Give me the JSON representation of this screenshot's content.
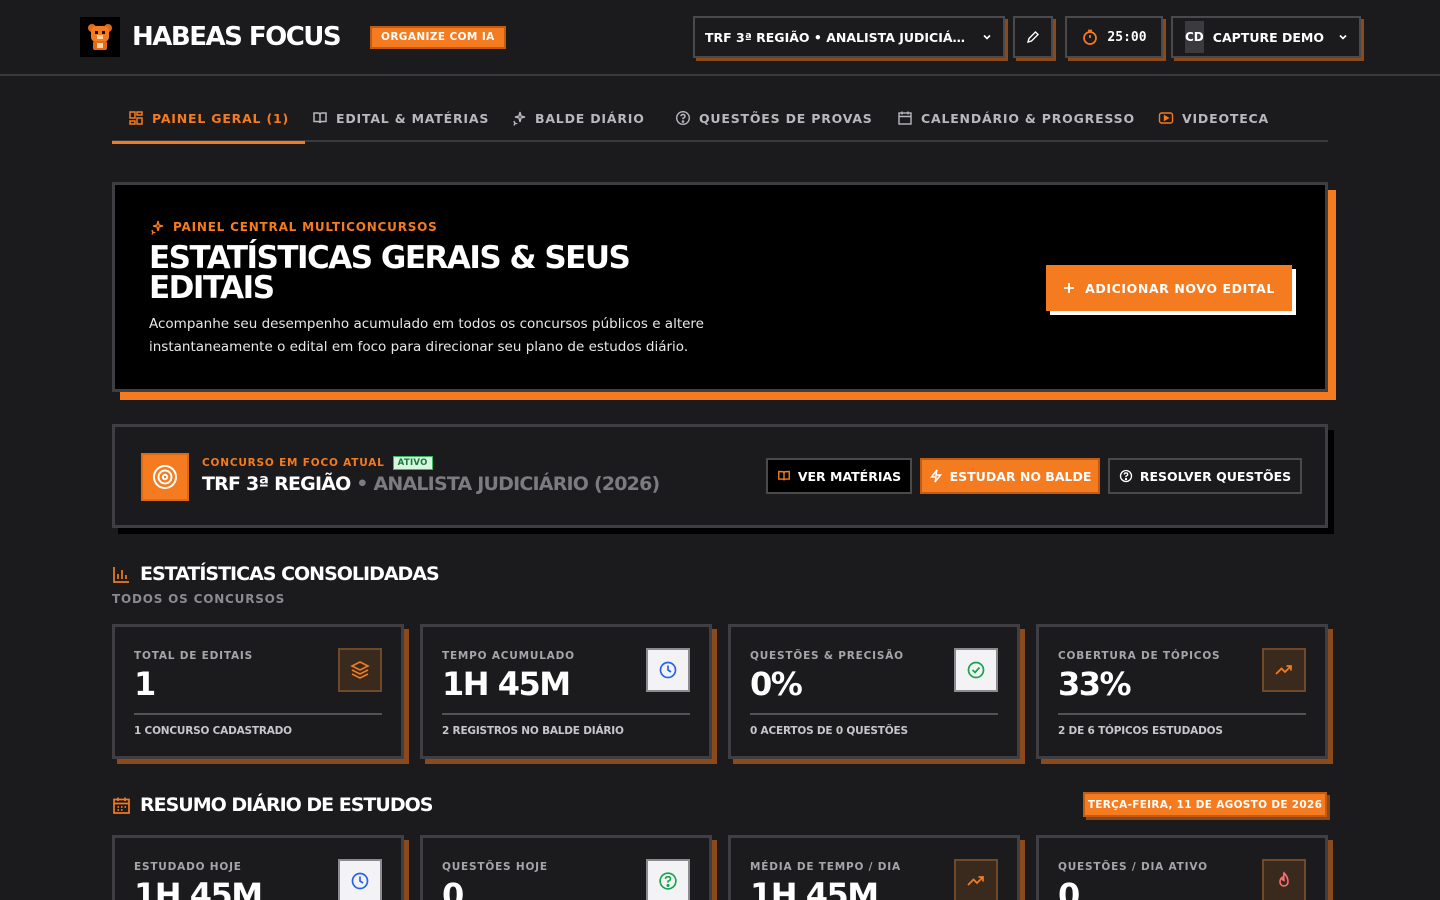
{
  "header": {
    "brand": "HABEAS FOCUS",
    "badge": "ORGANIZE COM IA",
    "concurso_select": "TRF 3ª REGIÃO • ANALISTA JUDICIÁRIO (2026)",
    "timer": "25:00",
    "user_initials": "CD",
    "user_name": "CAPTURE DEMO"
  },
  "tabs": [
    {
      "label": "PAINEL GERAL (1)",
      "icon": "grid-icon",
      "active": true
    },
    {
      "label": "EDITAL & MATÉRIAS",
      "icon": "book-icon"
    },
    {
      "label": "BALDE DIÁRIO",
      "icon": "sparkles-icon"
    },
    {
      "label": "QUESTÕES DE PROVAS",
      "icon": "help-circle-icon"
    },
    {
      "label": "CALENDÁRIO & PROGRESSO",
      "icon": "calendar-icon"
    },
    {
      "label": "VIDEOTECA",
      "icon": "video-icon"
    }
  ],
  "hero": {
    "kicker": "PAINEL CENTRAL MULTICONCURSOS",
    "title": "ESTATÍSTICAS GERAIS & SEUS EDITAIS",
    "description": "Acompanhe seu desempenho acumulado em todos os concursos públicos e altere instantaneamente o edital em foco para direcionar seu plano de estudos diário.",
    "add_button": "ADICIONAR NOVO EDITAL"
  },
  "focus": {
    "kicker": "CONCURSO EM FOCO ATUAL",
    "status": "ATIVO",
    "name": "TRF 3ª REGIÃO",
    "role": "• ANALISTA JUDICIÁRIO (2026)",
    "buttons": {
      "materias": "VER MATÉRIAS",
      "balde": "ESTUDAR NO BALDE",
      "questoes": "RESOLVER QUESTÕES"
    }
  },
  "consolidated": {
    "title": "ESTATÍSTICAS CONSOLIDADAS",
    "subtitle": "TODOS OS CONCURSOS",
    "cards": [
      {
        "label": "TOTAL DE EDITAIS",
        "value": "1",
        "foot": "1 CONCURSO CADASTRADO",
        "icon": "layers-icon"
      },
      {
        "label": "TEMPO ACUMULADO",
        "value": "1H 45M",
        "foot": "2 REGISTROS NO BALDE DIÁRIO",
        "icon": "clock-icon"
      },
      {
        "label": "QUESTÕES & PRECISÃO",
        "value": "0%",
        "foot": "0 ACERTOS DE 0 QUESTÕES",
        "icon": "check-circle-icon"
      },
      {
        "label": "COBERTURA DE TÓPICOS",
        "value": "33%",
        "foot": "2 DE 6 TÓPICOS ESTUDADOS",
        "icon": "trending-up-icon"
      }
    ]
  },
  "daily": {
    "title": "RESUMO DIÁRIO DE ESTUDOS",
    "date": "TERÇA-FEIRA, 11 DE AGOSTO DE 2026",
    "cards": [
      {
        "label": "ESTUDADO HOJE",
        "value": "1H 45M",
        "icon": "clock-icon"
      },
      {
        "label": "QUESTÕES HOJE",
        "value": "0",
        "icon": "help-circle-icon"
      },
      {
        "label": "MÉDIA DE TEMPO / DIA",
        "value": "1H 45M",
        "icon": "trending-up-icon"
      },
      {
        "label": "QUESTÕES / DIA ATIVO",
        "value": "0",
        "icon": "flame-icon"
      }
    ]
  },
  "colors": {
    "accent": "#f47b20",
    "background": "#1b1a1c",
    "success": "#3bb562"
  }
}
